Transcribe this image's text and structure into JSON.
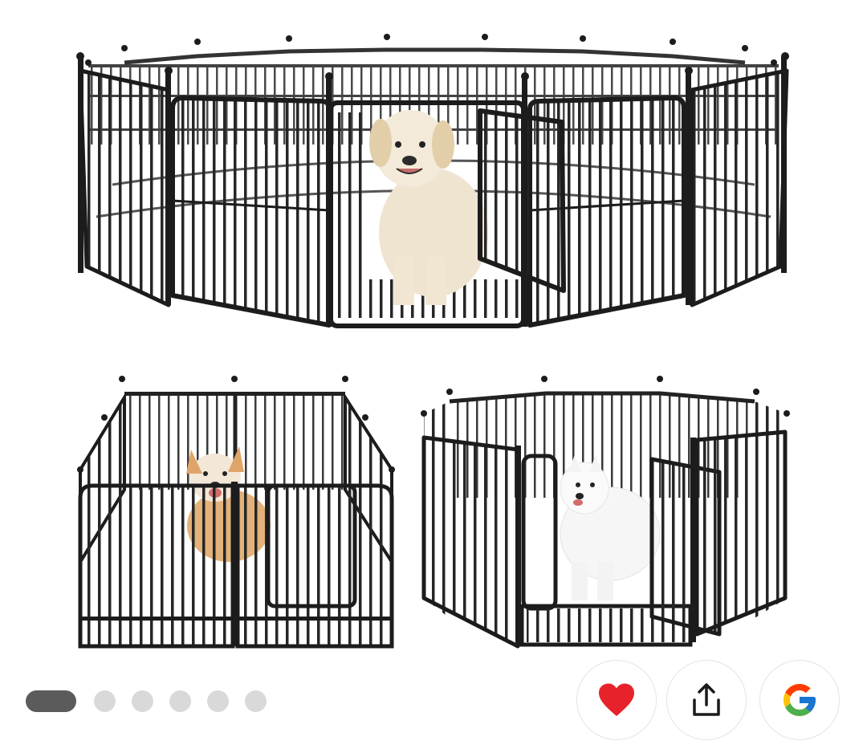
{
  "product": {
    "image_icon": "dog-playpen-product-image",
    "fence_color": "#2b2b2b",
    "photos": [
      {
        "dog": "golden-retriever",
        "panels": 16
      },
      {
        "dog": "corgi",
        "panels": 8
      },
      {
        "dog": "samoyed",
        "panels": 8
      }
    ]
  },
  "carousel": {
    "total": 6,
    "active_index": 0,
    "active_color": "#5b5b5b",
    "inactive_color": "#d9d9d9"
  },
  "actions": {
    "favorite": {
      "icon": "heart-icon",
      "color": "#e8222a",
      "active": true
    },
    "share": {
      "icon": "share-icon",
      "color": "#1a1a1a"
    },
    "google": {
      "icon": "google-logo-icon",
      "colors": [
        "#4285F4",
        "#EA4335",
        "#FBBC05",
        "#34A853"
      ]
    }
  }
}
